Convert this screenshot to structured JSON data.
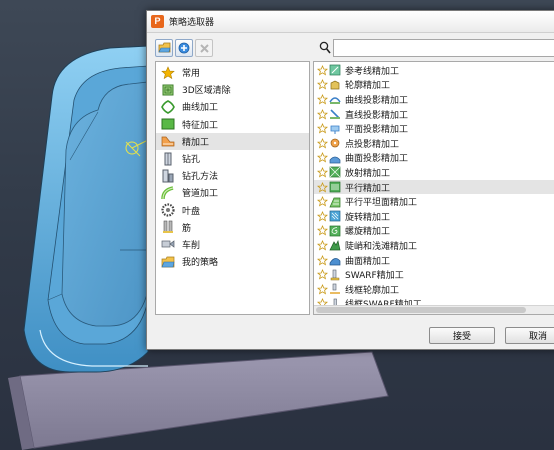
{
  "dialog": {
    "title": "策略选取器",
    "logo_letter": "P"
  },
  "search": {
    "value": "",
    "placeholder": ""
  },
  "categories": [
    {
      "label": "常用",
      "icon": "star-icon"
    },
    {
      "label": "3D区域清除",
      "icon": "area-clear-icon"
    },
    {
      "label": "曲线加工",
      "icon": "curve-icon"
    },
    {
      "label": "特征加工",
      "icon": "feature-icon"
    },
    {
      "label": "精加工",
      "icon": "finishing-icon",
      "selected": true
    },
    {
      "label": "钻孔",
      "icon": "drill-icon"
    },
    {
      "label": "钻孔方法",
      "icon": "drill-method-icon"
    },
    {
      "label": "管道加工",
      "icon": "pipe-icon"
    },
    {
      "label": "叶盘",
      "icon": "blisk-icon"
    },
    {
      "label": "筋",
      "icon": "rib-icon"
    },
    {
      "label": "车削",
      "icon": "turning-icon"
    },
    {
      "label": "我的策略",
      "icon": "folder-icon"
    }
  ],
  "strategies": [
    {
      "label": "参考线精加工",
      "icon": "reference-line-icon"
    },
    {
      "label": "轮廓精加工",
      "icon": "profile-icon"
    },
    {
      "label": "曲线投影精加工",
      "icon": "curve-projection-icon"
    },
    {
      "label": "直线投影精加工",
      "icon": "line-projection-icon"
    },
    {
      "label": "平面投影精加工",
      "icon": "plane-projection-icon"
    },
    {
      "label": "点投影精加工",
      "icon": "point-projection-icon"
    },
    {
      "label": "曲面投影精加工",
      "icon": "surface-projection-icon"
    },
    {
      "label": "放射精加工",
      "icon": "radial-icon"
    },
    {
      "label": "平行精加工",
      "icon": "raster-icon",
      "selected": true
    },
    {
      "label": "平行平坦面精加工",
      "icon": "raster-flat-icon"
    },
    {
      "label": "旋转精加工",
      "icon": "rotary-icon"
    },
    {
      "label": "螺旋精加工",
      "icon": "spiral-icon"
    },
    {
      "label": "陡峭和浅滩精加工",
      "icon": "steep-shallow-icon"
    },
    {
      "label": "曲面精加工",
      "icon": "surface-icon"
    },
    {
      "label": "SWARF精加工",
      "icon": "swarf-icon"
    },
    {
      "label": "线框轮廓加工",
      "icon": "wireframe-profile-icon"
    },
    {
      "label": "线框SWARF精加工",
      "icon": "wireframe-swarf-icon"
    }
  ],
  "buttons": {
    "accept": "接受",
    "cancel": "取消"
  },
  "colors": {
    "background": "#353d4b",
    "part_blue": "#6fb6e0",
    "block_gray": "#8e8aa2",
    "logo_orange": "#e8671c",
    "selection": "#e4e4e4",
    "star": "#f4b400"
  }
}
